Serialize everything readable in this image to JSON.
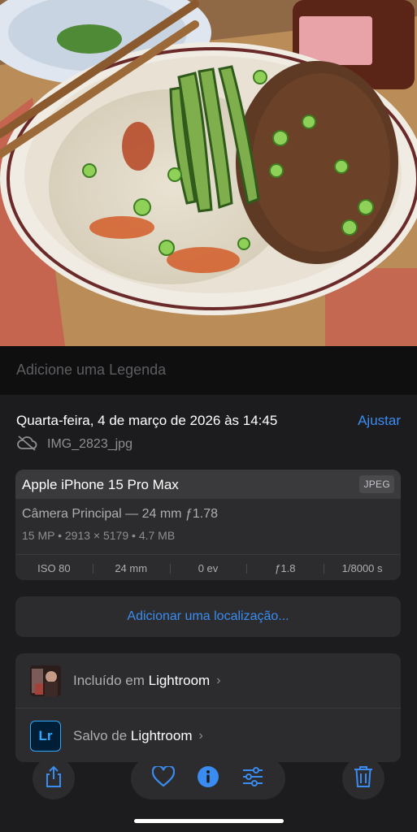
{
  "caption": {
    "placeholder": "Adicione uma Legenda"
  },
  "header": {
    "date": "Quarta-feira, 4 de março de 2026 às 14:45",
    "adjust_label": "Ajustar",
    "filename": "IMG_2823_jpg"
  },
  "device": {
    "name": "Apple iPhone 15 Pro Max",
    "format_badge": "JPEG",
    "lens": "Câmera Principal — 24 mm ƒ1.78",
    "specs": "15 MP • 2913 × 5179 • 4.7 MB",
    "exif": [
      "ISO 80",
      "24 mm",
      "0 ev",
      "ƒ1.8",
      "1/8000 s"
    ]
  },
  "location": {
    "add_label": "Adicionar uma localização..."
  },
  "links": {
    "included_prefix": "Incluído em",
    "included_app": "Lightroom",
    "saved_prefix": "Salvo de",
    "saved_app": "Lightroom",
    "lr_logo_text": "Lr",
    "chevron": "›"
  },
  "toolbar": {
    "icons": [
      "share-icon",
      "heart-icon",
      "info-icon",
      "adjust-sliders-icon",
      "trash-icon"
    ]
  },
  "colors": {
    "accent": "#3b8cf0",
    "panel": "#1c1c1e",
    "card": "#2c2c2e"
  }
}
